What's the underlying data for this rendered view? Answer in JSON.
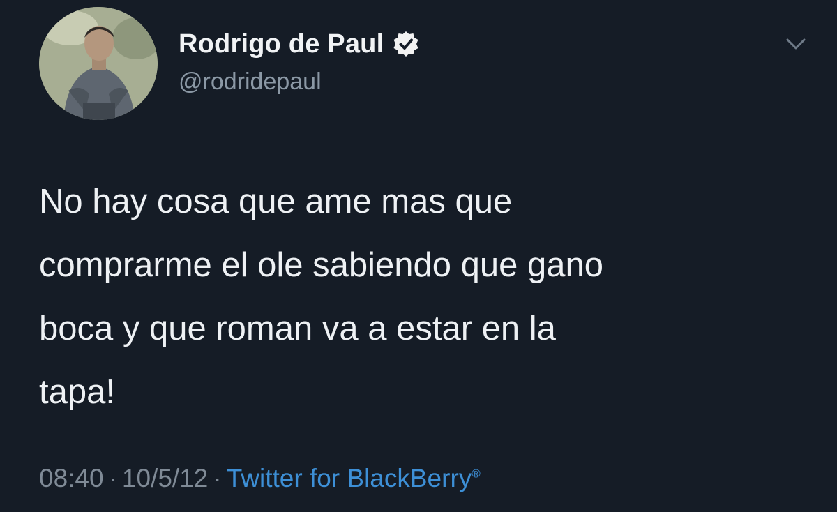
{
  "tweet": {
    "author": {
      "display_name": "Rodrigo de Paul",
      "handle": "@rodridepaul",
      "verified": true,
      "avatar_icon": "profile-photo-avatar",
      "verified_icon": "verified-badge-icon"
    },
    "menu_icon": "chevron-down-icon",
    "text_lines": [
      "No hay cosa que ame mas que",
      "comprarme el ole sabiendo que gano",
      "boca y que roman va a estar en la",
      "tapa!"
    ],
    "time": "08:40",
    "date": "10/5/12",
    "separator": "·",
    "source": "Twitter for BlackBerry",
    "source_mark": "®"
  },
  "colors": {
    "background": "#151c26",
    "text": "#eef1f4",
    "muted": "#8b98a5",
    "link": "#3d8fd6"
  }
}
